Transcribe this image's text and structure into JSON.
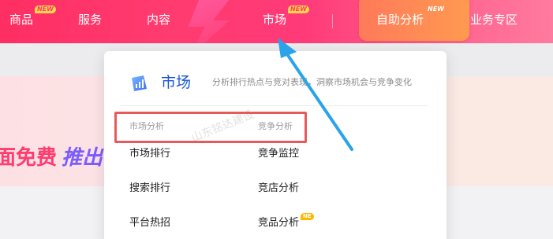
{
  "nav": {
    "items": [
      {
        "label": "商品",
        "badge": "NEW"
      },
      {
        "label": "服务"
      },
      {
        "label": "内容"
      },
      {
        "label": "市场",
        "badge": "NEW"
      },
      {
        "label": "自助分析",
        "badge": "NEW"
      },
      {
        "label": "业务专区"
      }
    ]
  },
  "banner": {
    "text_red": "面免费",
    "text_blue": "推出"
  },
  "dropdown": {
    "title": "市场",
    "description": "分析排行热点与竞对表现，洞察市场机会与竞争变化",
    "icon": "market-chart-icon",
    "columns": [
      {
        "heading": "市场分析",
        "items": [
          {
            "label": "市场排行"
          },
          {
            "label": "搜索排行"
          },
          {
            "label": "平台热招"
          }
        ]
      },
      {
        "heading": "竞争分析",
        "items": [
          {
            "label": "竞争监控"
          },
          {
            "label": "竞店分析"
          },
          {
            "label": "竞品分析",
            "badge": "NE"
          }
        ]
      }
    ]
  },
  "watermark": "山东铭达建设",
  "colors": {
    "nav_gradient_start": "#ff2e63",
    "nav_gradient_end": "#ff7a9e",
    "self_analysis_bg": "#ff9a50",
    "panel_title": "#1a56d6",
    "highlight_border": "#e85a5a",
    "arrow": "#2aa3e8"
  }
}
